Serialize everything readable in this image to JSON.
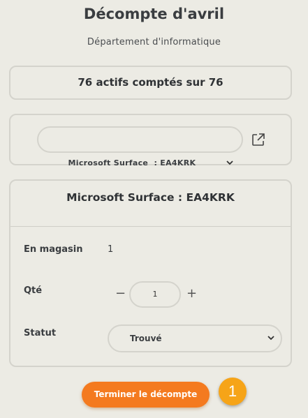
{
  "header": {
    "title": "Décompte d'avril",
    "subtitle": "Département d'informatique"
  },
  "summary": {
    "count_text": "76 actifs comptés sur 76"
  },
  "asset_selector": {
    "selected": "Microsoft Surface  : EA4KRK",
    "icon": "external-link-icon"
  },
  "detail": {
    "title": "Microsoft Surface : EA4KRK",
    "in_store_label": "En magasin",
    "in_store_value": "1",
    "qty_label": "Qté",
    "qty_minus": "−",
    "qty_value": "1",
    "qty_plus": "+",
    "status_label": "Statut",
    "status_selected": "Trouvé"
  },
  "actions": {
    "finish_label": "Terminer le décompte"
  },
  "badge": {
    "number": "1"
  },
  "colors": {
    "accent": "#f47a1f",
    "badge": "#f6a418",
    "background": "#ecebe4"
  }
}
